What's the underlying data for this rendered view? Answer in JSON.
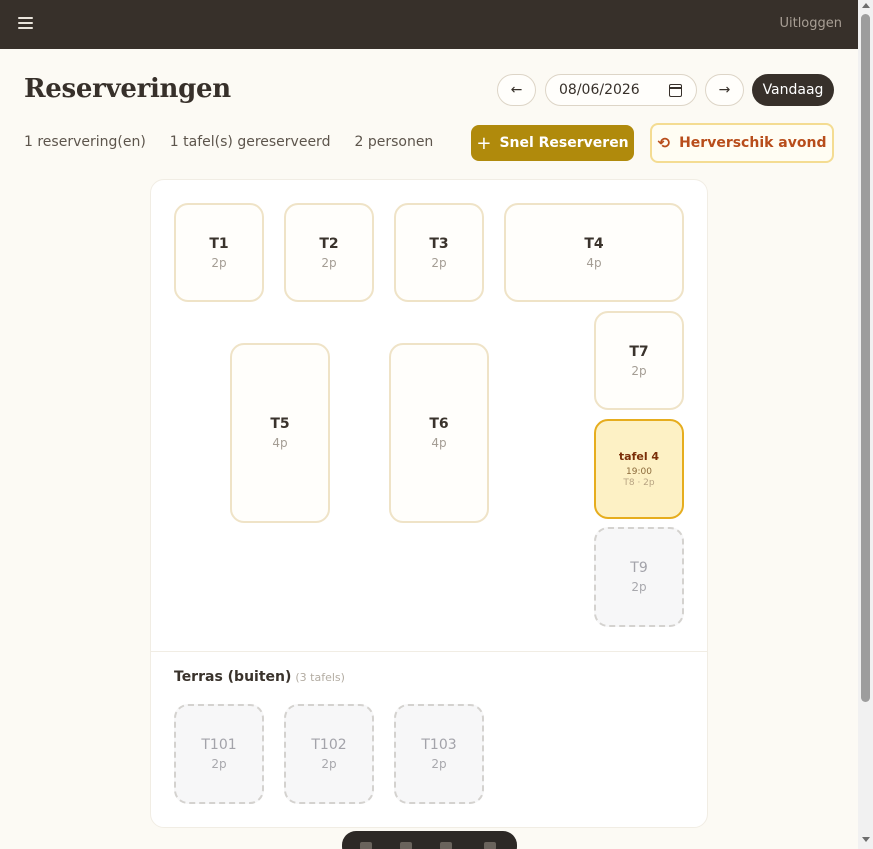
{
  "header": {
    "logout_label": "Uitloggen"
  },
  "page": {
    "title": "Reserveringen"
  },
  "nav": {
    "prev": "←",
    "next": "→",
    "date_value": "08/06/2026",
    "today_label": "Vandaag"
  },
  "stats": {
    "reservations": "1 reservering(en)",
    "tables": "1 tafel(s) gereserveerd",
    "persons": "2 personen"
  },
  "actions": {
    "quick_reserve": "Snel Reserveren",
    "rearrange": "Herverschik avond",
    "plus": "+",
    "refresh": "⟲"
  },
  "tables": [
    {
      "name": "T1",
      "cap": "2p"
    },
    {
      "name": "T2",
      "cap": "2p"
    },
    {
      "name": "T3",
      "cap": "2p"
    },
    {
      "name": "T4",
      "cap": "4p"
    },
    {
      "name": "T5",
      "cap": "4p"
    },
    {
      "name": "T6",
      "cap": "4p"
    },
    {
      "name": "T7",
      "cap": "2p"
    },
    {
      "name": "T9",
      "cap": "2p"
    }
  ],
  "reserved_table": {
    "name": "tafel 4",
    "time": "19:00",
    "sub": "T8 · 2p"
  },
  "terras": {
    "title": "Terras (buiten)",
    "count": "(3 tafels)",
    "tables": [
      {
        "name": "T101",
        "cap": "2p"
      },
      {
        "name": "T102",
        "cap": "2p"
      },
      {
        "name": "T103",
        "cap": "2p"
      }
    ]
  }
}
